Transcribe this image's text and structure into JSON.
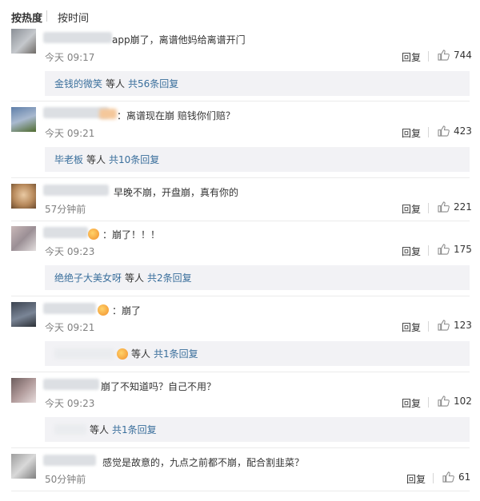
{
  "sort": {
    "hot": "按热度",
    "time": "按时间"
  },
  "comments": [
    {
      "text": "app崩了，离谱他妈给离谱开门",
      "time": "今天 09:17",
      "reply": "回复",
      "likes": "744",
      "reply_box": {
        "user": "金钱的微笑",
        "etc": "等人",
        "count": "共56条回复"
      }
    },
    {
      "text": "：离谱现在崩 赔钱你们赔？",
      "time": "今天 09:21",
      "reply": "回复",
      "likes": "423",
      "reply_box": {
        "user": "毕老板",
        "etc": "等人",
        "count": "共10条回复"
      }
    },
    {
      "text": "早晚不崩，开盘崩，真有你的",
      "time": "57分钟前",
      "reply": "回复",
      "likes": "221"
    },
    {
      "text": "：崩了！！！",
      "time": "今天 09:23",
      "reply": "回复",
      "likes": "175",
      "reply_box": {
        "user": "绝绝子大美女呀",
        "etc": "等人",
        "count": "共2条回复"
      }
    },
    {
      "text": "：崩了",
      "time": "今天 09:21",
      "reply": "回复",
      "likes": "123",
      "reply_box": {
        "user": "",
        "etc": "等人",
        "count": "共1条回复"
      }
    },
    {
      "text": "崩了不知道吗？自己不用？",
      "time": "今天 09:23",
      "reply": "回复",
      "likes": "102",
      "reply_box": {
        "user": "",
        "etc": "等人",
        "count": "共1条回复"
      }
    },
    {
      "text": "感觉是故意的，九点之前都不崩，配合割韭菜？",
      "time": "50分钟前",
      "reply": "回复",
      "likes": "61"
    }
  ],
  "colors": {
    "link": "#3a6f9c",
    "reply_bg": "#f2f2f5",
    "muted": "#808080"
  }
}
